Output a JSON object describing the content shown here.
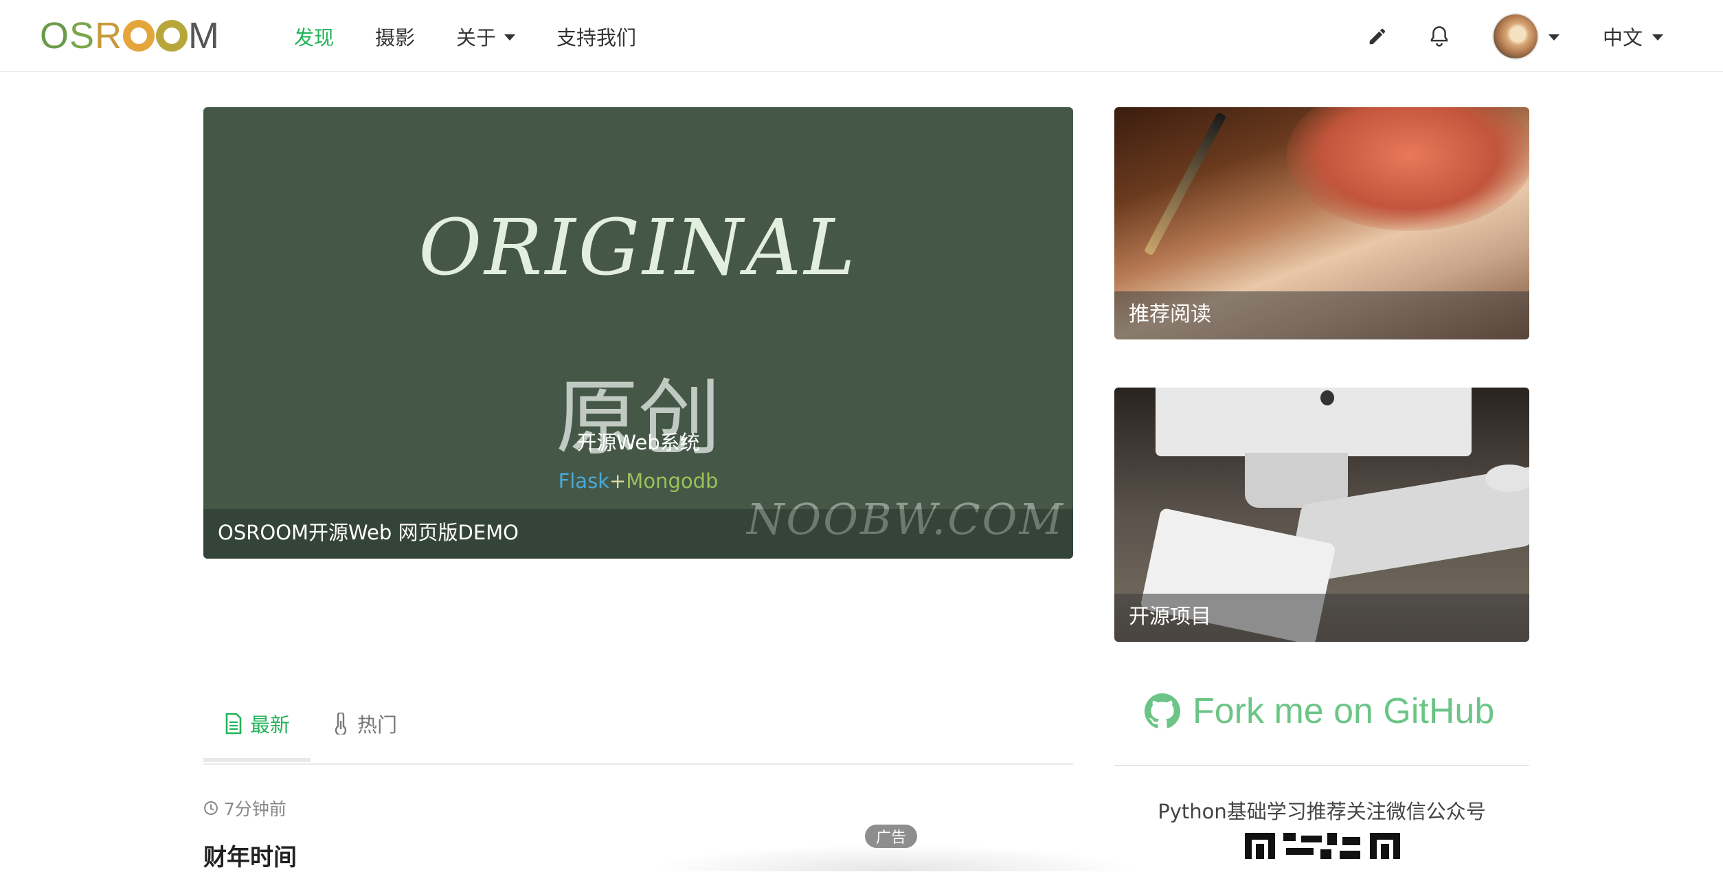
{
  "navbar": {
    "logo": "OSROOM",
    "links": [
      {
        "label": "发现",
        "active": true
      },
      {
        "label": "摄影"
      },
      {
        "label": "关于",
        "dropdown": true
      },
      {
        "label": "支持我们"
      }
    ],
    "language": "中文",
    "icons": [
      "pencil-icon",
      "bell-icon",
      "avatar",
      "caret-down-icon"
    ]
  },
  "carousel": {
    "image_title": "ORIGINAL",
    "image_subtitle_cn": "原创",
    "image_tagline": "开源Web系统",
    "stack_flask": "Flask",
    "stack_plus": "+",
    "stack_mongo": "Mongodb",
    "watermark": "NOOBW.COM",
    "caption": "OSROOM开源Web 网页版DEMO"
  },
  "side_cards": [
    {
      "label": "推荐阅读"
    },
    {
      "label": "开源项目"
    }
  ],
  "github": {
    "label": "Fork me on GitHub"
  },
  "wechat": {
    "text": "Python基础学习推荐关注微信公众号"
  },
  "tabs": [
    {
      "label": "最新",
      "active": true,
      "icon": "file-text-icon"
    },
    {
      "label": "热门",
      "active": false,
      "icon": "thermometer-icon"
    }
  ],
  "post": {
    "time": "7分钟前",
    "title": "财年时间"
  },
  "ad": {
    "badge": "广告"
  },
  "colors": {
    "accent": "#22b35a",
    "github_green": "#6cc586",
    "carousel_bg": "#455848"
  }
}
